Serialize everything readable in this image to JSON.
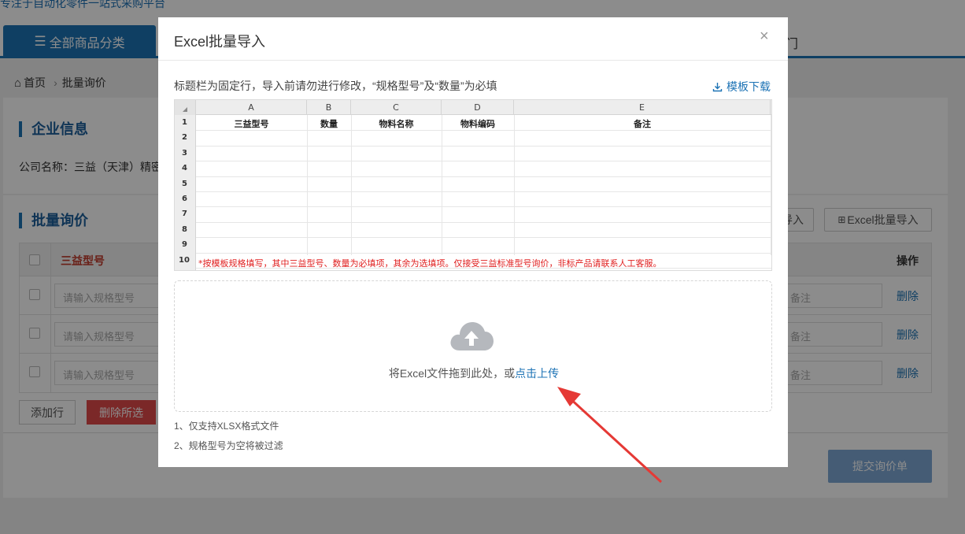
{
  "page": {
    "slogan": "专注于自动化零件一站式采购平台",
    "nav_all": "全部商品分类",
    "nav_right": "门",
    "breadcrumb": {
      "home": "首页",
      "current": "批量询价"
    },
    "company_section": {
      "title": "企业信息",
      "company_label": "公司名称：三益（天津）精密"
    },
    "inquiry_section": {
      "title": "批量询价",
      "btn_import_partial": "导入",
      "btn_excel_import": "Excel批量导入",
      "col_model": "三益型号",
      "col_op": "操作",
      "rows": [
        {
          "model_placeholder": "请输入规格型号",
          "remark_placeholder": "备注",
          "delete": "删除"
        },
        {
          "model_placeholder": "请输入规格型号",
          "remark_placeholder": "备注",
          "delete": "删除"
        },
        {
          "model_placeholder": "请输入规格型号",
          "remark_placeholder": "备注",
          "delete": "删除"
        }
      ],
      "btn_add_row": "添加行",
      "btn_delete_selected": "删除所选",
      "btn_submit": "提交询价单"
    }
  },
  "modal": {
    "title": "Excel批量导入",
    "close_glyph": "×",
    "tip": "标题栏为固定行，导入前请勿进行修改，“规格型号”及“数量”为必填",
    "template_download": "模板下载",
    "sheet": {
      "columns": [
        "A",
        "B",
        "C",
        "D",
        "E"
      ],
      "row_numbers": [
        "1",
        "2",
        "3",
        "4",
        "5",
        "6",
        "7",
        "8",
        "9",
        "10"
      ],
      "headers": [
        "三益型号",
        "数量",
        "物料名称",
        "物料编码",
        "备注"
      ],
      "note": "*按模板规格填写，其中三益型号、数量为必填项，其余为选填项。仅接受三益标准型号询价，非标产品请联系人工客服。"
    },
    "upload": {
      "text": "将Excel文件拖到此处，或",
      "link": "点击上传"
    },
    "notes": [
      "1、仅支持XLSX格式文件",
      "2、规格型号为空将被过滤"
    ]
  },
  "colors": {
    "accent": "#1d73b5",
    "danger": "#e04949",
    "required_red": "#e02020",
    "arrow": "#e53935"
  }
}
